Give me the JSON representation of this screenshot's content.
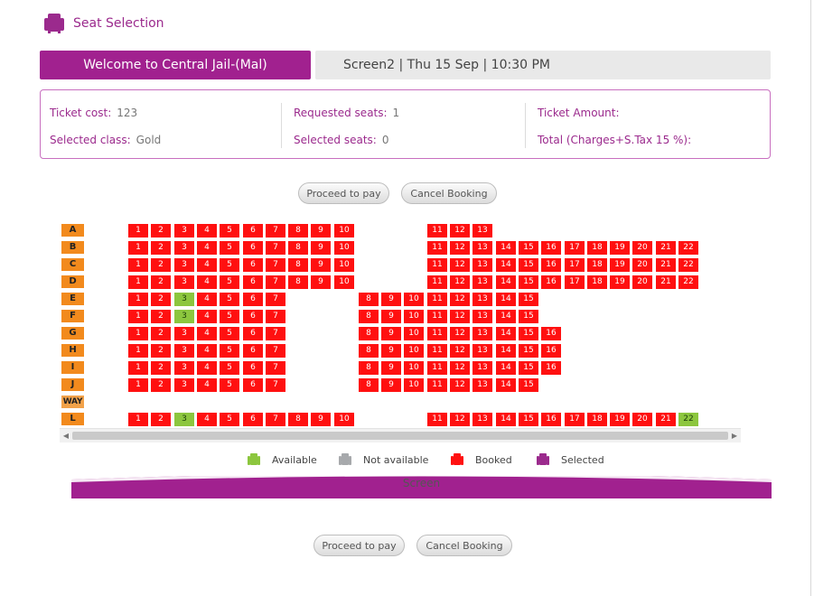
{
  "header": {
    "title": "Seat Selection"
  },
  "welcome": "Welcome to Central Jail-(Mal)",
  "show_info": "Screen2 | Thu 15 Sep | 10:30 PM",
  "info": {
    "ticket_cost_label": "Ticket cost:",
    "ticket_cost_value": "123",
    "selected_class_label": "Selected class:",
    "selected_class_value": "Gold",
    "requested_seats_label": "Requested seats:",
    "requested_seats_value": "1",
    "selected_seats_label": "Selected seats:",
    "selected_seats_value": "0",
    "ticket_amount_label": "Ticket Amount:",
    "total_label": "Total (Charges+S.Tax 15 %):"
  },
  "buttons": {
    "proceed": "Proceed to pay",
    "cancel": "Cancel Booking"
  },
  "seatmap": {
    "rows": [
      {
        "label": "A",
        "left": [
          1,
          2,
          3,
          4,
          5,
          6,
          7,
          8,
          9,
          10
        ],
        "right": [
          11,
          12,
          13
        ],
        "available": []
      },
      {
        "label": "B",
        "left": [
          1,
          2,
          3,
          4,
          5,
          6,
          7,
          8,
          9,
          10
        ],
        "right": [
          11,
          12,
          13,
          14,
          15,
          16,
          17,
          18,
          19,
          20,
          21,
          22
        ],
        "available": []
      },
      {
        "label": "C",
        "left": [
          1,
          2,
          3,
          4,
          5,
          6,
          7,
          8,
          9,
          10
        ],
        "right": [
          11,
          12,
          13,
          14,
          15,
          16,
          17,
          18,
          19,
          20,
          21,
          22
        ],
        "available": []
      },
      {
        "label": "D",
        "left": [
          1,
          2,
          3,
          4,
          5,
          6,
          7,
          8,
          9,
          10
        ],
        "right": [
          11,
          12,
          13,
          14,
          15,
          16,
          17,
          18,
          19,
          20,
          21,
          22
        ],
        "available": []
      },
      {
        "label": "E",
        "left": [
          1,
          2,
          3,
          4,
          5,
          6,
          7
        ],
        "right": [
          8,
          9,
          10,
          11,
          12,
          13,
          14,
          15
        ],
        "available": [
          3
        ]
      },
      {
        "label": "F",
        "left": [
          1,
          2,
          3,
          4,
          5,
          6,
          7
        ],
        "right": [
          8,
          9,
          10,
          11,
          12,
          13,
          14,
          15
        ],
        "available": [
          3
        ]
      },
      {
        "label": "G",
        "left": [
          1,
          2,
          3,
          4,
          5,
          6,
          7
        ],
        "right": [
          8,
          9,
          10,
          11,
          12,
          13,
          14,
          15,
          16
        ],
        "available": []
      },
      {
        "label": "H",
        "left": [
          1,
          2,
          3,
          4,
          5,
          6,
          7
        ],
        "right": [
          8,
          9,
          10,
          11,
          12,
          13,
          14,
          15,
          16
        ],
        "available": []
      },
      {
        "label": "I",
        "left": [
          1,
          2,
          3,
          4,
          5,
          6,
          7
        ],
        "right": [
          8,
          9,
          10,
          11,
          12,
          13,
          14,
          15,
          16
        ],
        "available": []
      },
      {
        "label": "J",
        "left": [
          1,
          2,
          3,
          4,
          5,
          6,
          7
        ],
        "right": [
          8,
          9,
          10,
          11,
          12,
          13,
          14,
          15
        ],
        "available": []
      },
      {
        "label": "WAY",
        "left": [],
        "right": [],
        "available": []
      },
      {
        "label": "L",
        "left": [
          1,
          2,
          3,
          4,
          5,
          6,
          7,
          8,
          9,
          10
        ],
        "right": [
          11,
          12,
          13,
          14,
          15,
          16,
          17,
          18,
          19,
          20,
          21,
          22
        ],
        "available": [
          3,
          22
        ]
      }
    ]
  },
  "legend": [
    {
      "label": "Available",
      "color": "#8cc63e",
      "icon": "seat-icon"
    },
    {
      "label": "Not available",
      "color": "#a7a9ac",
      "icon": "seat-icon"
    },
    {
      "label": "Booked",
      "color": "#ff1010",
      "icon": "seat-icon"
    },
    {
      "label": "Selected",
      "color": "#9b2a8d",
      "icon": "seat-icon"
    }
  ],
  "screen_label": "Screen",
  "colors": {
    "accent": "#a1218f",
    "booked": "#ff1010",
    "available": "#8cc63e",
    "not_available": "#a7a9ac",
    "row_label": "#f28a1d"
  }
}
